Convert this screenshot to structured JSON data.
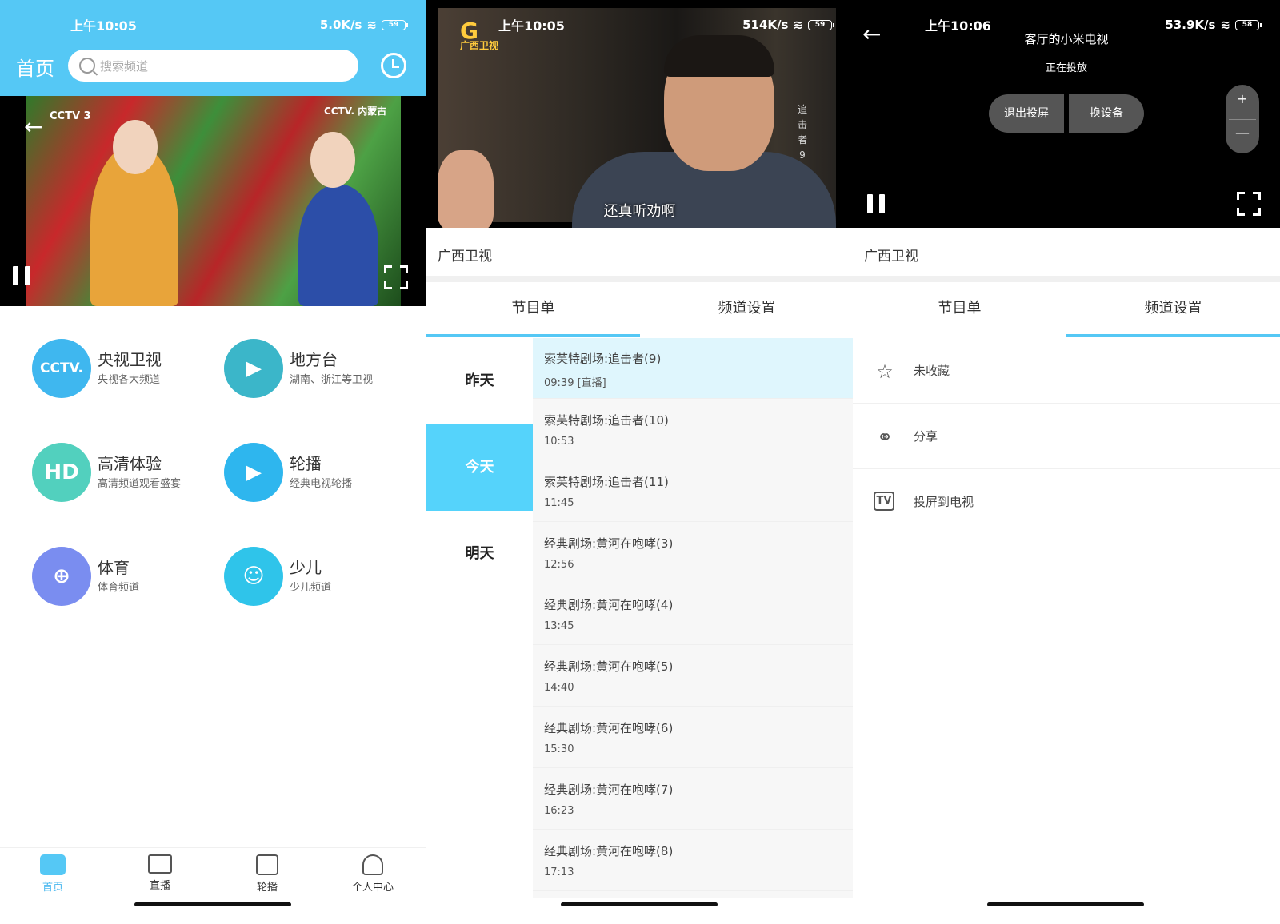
{
  "panel1": {
    "status": {
      "time": "上午10:05",
      "speed": "5.0K/s",
      "battery": "59"
    },
    "header": {
      "title": "首页",
      "search_placeholder": "搜索频道"
    },
    "video": {
      "logo_left": "CCTV 3",
      "logo_right": "CCTV. 内蒙古"
    },
    "categories": [
      {
        "name": "央视卫视",
        "desc": "央视各大频道",
        "icon_text": "CCTV.",
        "color": "#3fb7ef"
      },
      {
        "name": "地方台",
        "desc": "湖南、浙江等卫视",
        "icon_text": "▶",
        "color": "#3bb6c9"
      },
      {
        "name": "高清体验",
        "desc": "高清频道观看盛宴",
        "icon_text": "HD",
        "color": "#52d0be"
      },
      {
        "name": "轮播",
        "desc": "经典电视轮播",
        "icon_text": "▶",
        "color": "#2eb6ee"
      },
      {
        "name": "体育",
        "desc": "体育频道",
        "icon_text": "⊕",
        "color": "#7a8df0"
      },
      {
        "name": "少儿",
        "desc": "少儿频道",
        "icon_text": "☺",
        "color": "#2fc4ea"
      }
    ],
    "tabs": [
      {
        "label": "首页",
        "icon": "home-icon"
      },
      {
        "label": "直播",
        "icon": "camera-icon"
      },
      {
        "label": "轮播",
        "icon": "tv-play-icon"
      },
      {
        "label": "个人中心",
        "icon": "user-icon"
      }
    ],
    "accent": "#55c8f5"
  },
  "panel2": {
    "status": {
      "time": "上午10:05",
      "speed": "514K/s",
      "battery": "59"
    },
    "video": {
      "station_name": "广西卫视",
      "subtitle": "还真听劝啊",
      "vertical_text": "追击者9"
    },
    "channel_title": "广西卫视",
    "sub_tabs": [
      "节目单",
      "频道设置"
    ],
    "days": [
      "昨天",
      "今天",
      "明天"
    ],
    "programs": [
      {
        "name": "索芙特剧场:追击者(9)",
        "time": "09:39 [直播]"
      },
      {
        "name": "索芙特剧场:追击者(10)",
        "time": "10:53"
      },
      {
        "name": "索芙特剧场:追击者(11)",
        "time": "11:45"
      },
      {
        "name": "经典剧场:黄河在咆哮(3)",
        "time": "12:56"
      },
      {
        "name": "经典剧场:黄河在咆哮(4)",
        "time": "13:45"
      },
      {
        "name": "经典剧场:黄河在咆哮(5)",
        "time": "14:40"
      },
      {
        "name": "经典剧场:黄河在咆哮(6)",
        "time": "15:30"
      },
      {
        "name": "经典剧场:黄河在咆哮(7)",
        "time": "16:23"
      },
      {
        "name": "经典剧场:黄河在咆哮(8)",
        "time": "17:13"
      }
    ]
  },
  "panel3": {
    "status": {
      "time": "上午10:06",
      "speed": "53.9K/s",
      "battery": "58"
    },
    "cast": {
      "device": "客厅的小米电视",
      "status": "正在投放",
      "exit_label": "退出投屏",
      "switch_label": "换设备",
      "plus": "+",
      "minus": "—"
    },
    "channel_title": "广西卫视",
    "sub_tabs": [
      "节目单",
      "频道设置"
    ],
    "settings": [
      {
        "label": "未收藏",
        "icon": "star-icon"
      },
      {
        "label": "分享",
        "icon": "share-icon"
      },
      {
        "label": "投屏到电视",
        "icon": "cast-tv-icon"
      }
    ]
  }
}
